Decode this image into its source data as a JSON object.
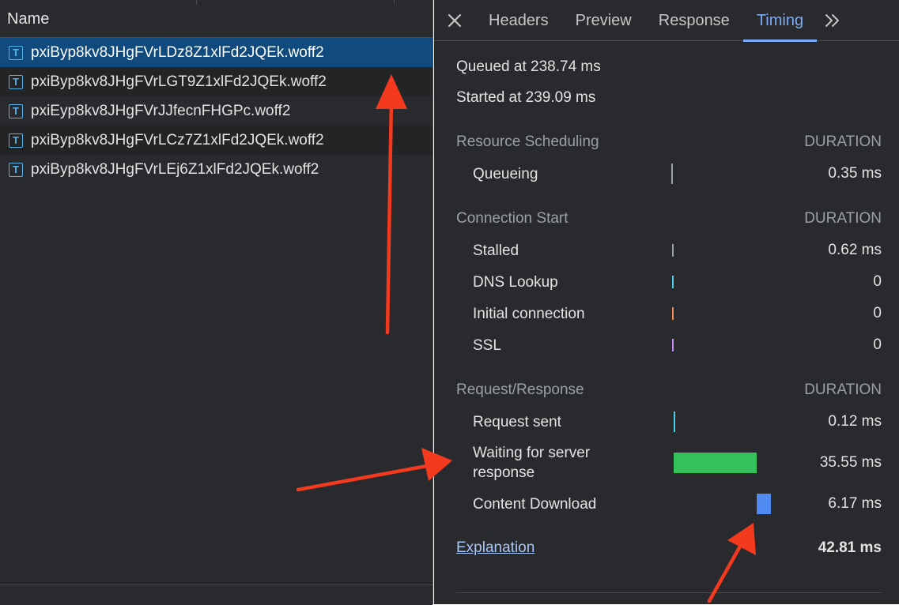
{
  "left_panel": {
    "header": "Name",
    "files": [
      {
        "name": "pxiByp8kv8JHgFVrLDz8Z1xlFd2JQEk.woff2",
        "icon": "font-file-icon",
        "icon_glyph": "T",
        "selected": true
      },
      {
        "name": "pxiByp8kv8JHgFVrLGT9Z1xlFd2JQEk.woff2",
        "icon": "font-file-icon",
        "icon_glyph": "T",
        "selected": false
      },
      {
        "name": "pxiEyp8kv8JHgFVrJJfecnFHGPc.woff2",
        "icon": "font-file-icon",
        "icon_glyph": "T",
        "selected": false
      },
      {
        "name": "pxiByp8kv8JHgFVrLCz7Z1xlFd2JQEk.woff2",
        "icon": "font-file-icon",
        "icon_glyph": "T",
        "selected": false
      },
      {
        "name": "pxiByp8kv8JHgFVrLEj6Z1xlFd2JQEk.woff2",
        "icon": "font-file-icon",
        "icon_glyph": "T",
        "selected": false
      }
    ]
  },
  "tabs": {
    "close_icon": "close-icon",
    "items": [
      "Headers",
      "Preview",
      "Response",
      "Timing"
    ],
    "active": "Timing",
    "more_icon": "chevron-double-right-icon"
  },
  "timing": {
    "queued": "Queued at 238.74 ms",
    "started": "Started at 239.09 ms",
    "sections": [
      {
        "title": "Resource Scheduling",
        "duration_label": "DURATION",
        "rows": [
          {
            "label": "Queueing",
            "value": "0.35 ms",
            "color": "#9aa0a6"
          }
        ]
      },
      {
        "title": "Connection Start",
        "duration_label": "DURATION",
        "rows": [
          {
            "label": "Stalled",
            "value": "0.62 ms",
            "color": "#9aa0a6"
          },
          {
            "label": "DNS Lookup",
            "value": "0",
            "color": "#4ecde6"
          },
          {
            "label": "Initial connection",
            "value": "0",
            "color": "#ee8a55"
          },
          {
            "label": "SSL",
            "value": "0",
            "color": "#c58af9"
          }
        ]
      },
      {
        "title": "Request/Response",
        "duration_label": "DURATION",
        "rows": [
          {
            "label": "Request sent",
            "value": "0.12 ms",
            "color": "#4ecde6"
          },
          {
            "label": "Waiting for server response",
            "value": "35.55 ms",
            "color": "#34c05a"
          },
          {
            "label": "Content Download",
            "value": "6.17 ms",
            "color": "#4f8bf1"
          }
        ]
      }
    ],
    "explanation_link": "Explanation",
    "total": "42.81 ms"
  },
  "colors": {
    "panel_bg": "#292a2d",
    "selected_row": "#114a7c",
    "accent": "#7cacf8",
    "annotation_arrow": "#f43a1e"
  }
}
